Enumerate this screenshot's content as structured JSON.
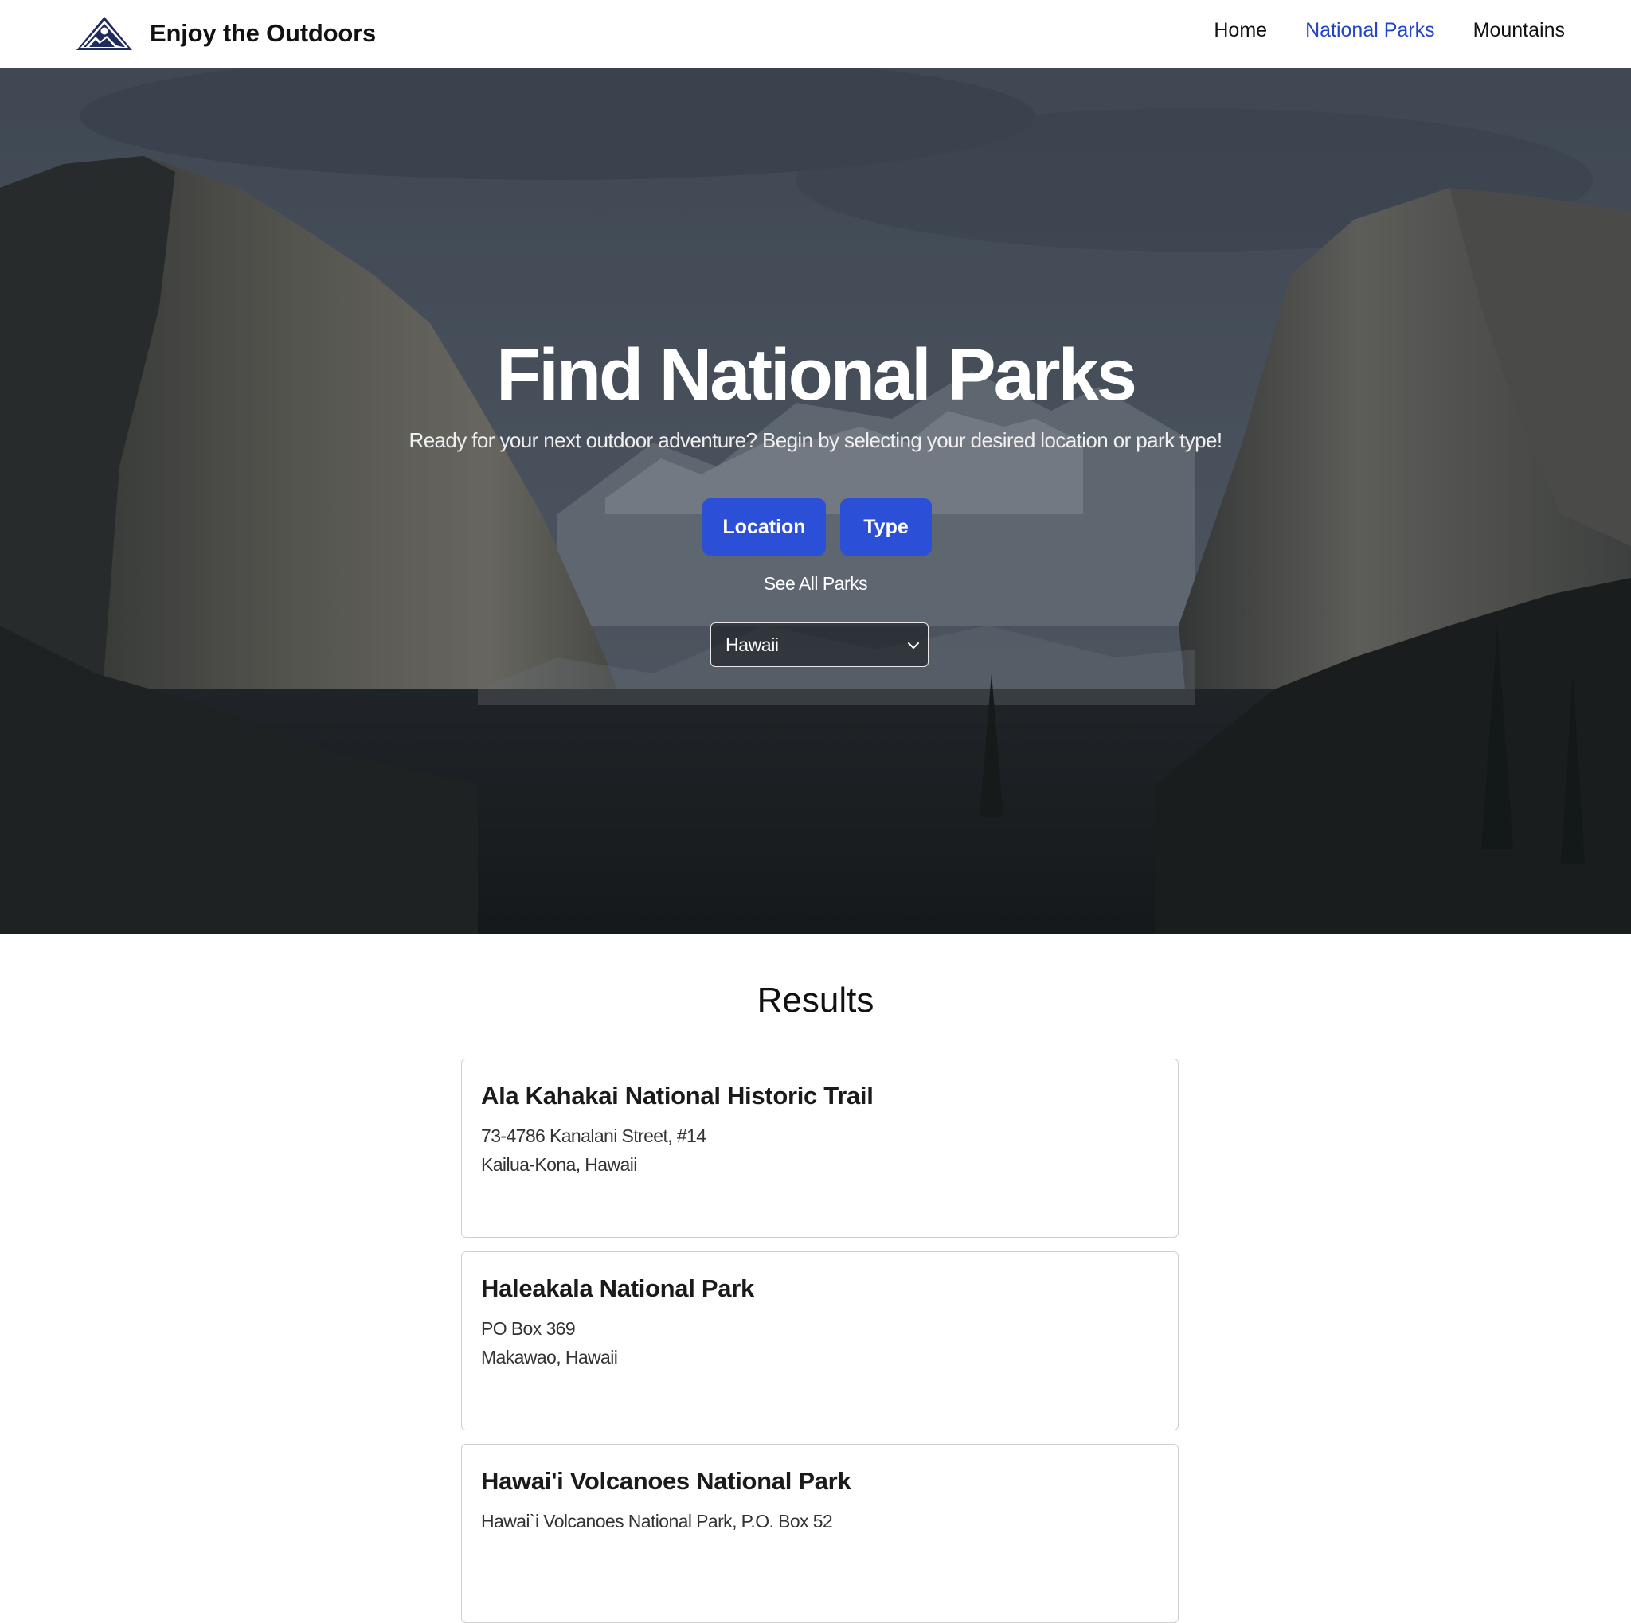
{
  "header": {
    "brand": "Enjoy the Outdoors",
    "nav": [
      {
        "label": "Home",
        "active": false
      },
      {
        "label": "National Parks",
        "active": true
      },
      {
        "label": "Mountains",
        "active": false
      }
    ],
    "accent_color": "#2344c6"
  },
  "hero": {
    "title": "Find National Parks",
    "subtitle": "Ready for your next outdoor adventure? Begin by selecting your desired location or park type!",
    "buttons": {
      "location": "Location",
      "type": "Type"
    },
    "see_all": "See All Parks",
    "select": {
      "selected": "Hawaii"
    },
    "button_color": "#2c4fd8"
  },
  "results": {
    "title": "Results",
    "cards": [
      {
        "name": "Ala Kahakai National Historic Trail",
        "address": "73-4786 Kanalani Street, #14",
        "city": "Kailua-Kona, Hawaii"
      },
      {
        "name": "Haleakala National Park",
        "address": "PO Box 369",
        "city": "Makawao, Hawaii"
      },
      {
        "name": "Hawai'i Volcanoes National Park",
        "address": "Hawai`i Volcanoes National Park, P.O. Box 52",
        "city": ""
      }
    ]
  }
}
